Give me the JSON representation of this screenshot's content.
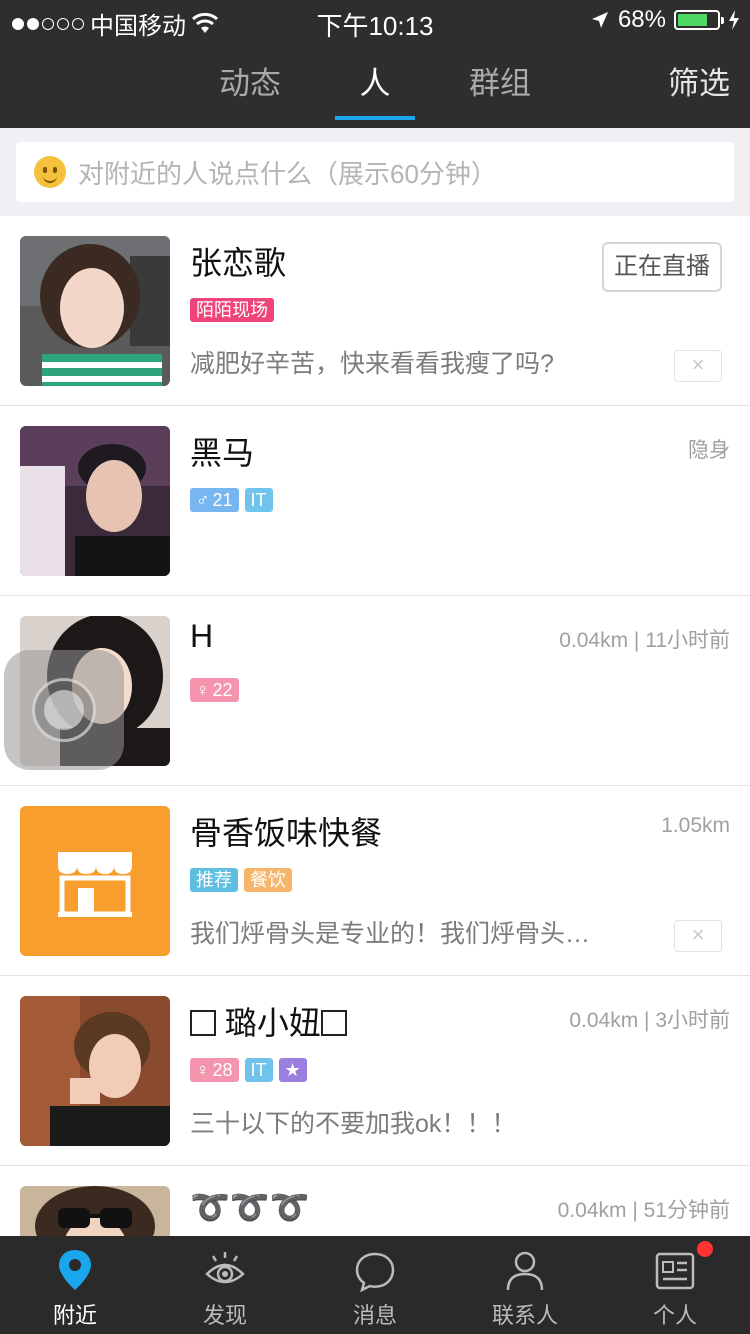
{
  "status_bar": {
    "carrier": "中国移动",
    "time": "下午10:13",
    "battery_percent": "68%",
    "battery_level": 0.68,
    "signal_bars_filled": 2,
    "signal_bars_total": 5
  },
  "top_nav": {
    "tabs": [
      {
        "label": "动态",
        "active": false
      },
      {
        "label": "人",
        "active": true
      },
      {
        "label": "群组",
        "active": false
      }
    ],
    "filter_label": "筛选"
  },
  "say_bar": {
    "placeholder": "对附近的人说点什么（展示60分钟）"
  },
  "people": [
    {
      "name": "张恋歌",
      "tags": [
        {
          "text": "陌陌现场",
          "color": "#f0437a"
        }
      ],
      "signature": "减肥好辛苦，快来看看我瘦了吗?",
      "action_label": "正在直播",
      "dismiss": "×"
    },
    {
      "name": "黑马",
      "meta": "隐身",
      "tags": [
        {
          "text": "21",
          "icon": "♂",
          "color": "#77b6f0"
        },
        {
          "text": "IT",
          "color": "#6fc3ec"
        }
      ]
    },
    {
      "name": "H",
      "meta": "0.04km | 11小时前",
      "tags": [
        {
          "text": "22",
          "icon": "♀",
          "color": "#f595ad"
        }
      ]
    },
    {
      "name": "骨香饭味快餐",
      "meta": "1.05km",
      "tags": [
        {
          "text": "推荐",
          "color": "#5fbfe0"
        },
        {
          "text": "餐饮",
          "color": "#f5b56a"
        }
      ],
      "signature": "我们烀骨头是专业的！我们烀骨头…",
      "dismiss": "×"
    },
    {
      "name": "璐小妞",
      "meta": "0.04km | 3小时前",
      "tags": [
        {
          "text": "28",
          "icon": "♀",
          "color": "#f595ad"
        },
        {
          "text": "IT",
          "color": "#6fc3ec"
        },
        {
          "text": "★",
          "color": "#9b7fe0"
        }
      ],
      "signature": "三十以下的不要加我ok！！！"
    },
    {
      "name": "➰➰➰",
      "meta": "0.04km | 51分钟前",
      "tags": []
    }
  ],
  "bottom_tabs": [
    {
      "label": "附近",
      "icon": "location-pin-icon",
      "active": true
    },
    {
      "label": "发现",
      "icon": "eye-icon",
      "active": false
    },
    {
      "label": "消息",
      "icon": "chat-bubble-icon",
      "active": false
    },
    {
      "label": "联系人",
      "icon": "contact-person-icon",
      "active": false
    },
    {
      "label": "个人",
      "icon": "profile-card-icon",
      "active": false,
      "badge": true
    }
  ],
  "colors": {
    "accent": "#1aa6ec",
    "nav_bg": "#2e2e2e",
    "tabbar_bg": "#2a2a2a",
    "badge_red": "#ff3333",
    "shop_orange": "#f79e2d"
  }
}
